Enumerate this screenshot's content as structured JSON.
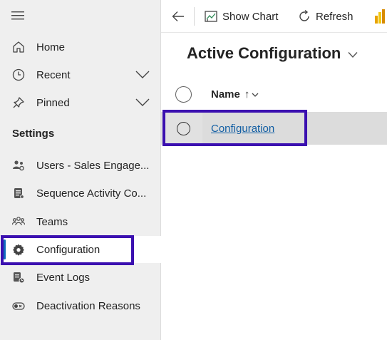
{
  "sidebar": {
    "items": [
      {
        "label": "Home",
        "icon": "home-icon"
      },
      {
        "label": "Recent",
        "icon": "clock-icon"
      },
      {
        "label": "Pinned",
        "icon": "pin-icon"
      }
    ],
    "section_title": "Settings",
    "settings_items": [
      {
        "label": "Users - Sales Engage...",
        "icon": "users-gear-icon"
      },
      {
        "label": "Sequence Activity Co...",
        "icon": "document-list-icon"
      },
      {
        "label": "Teams",
        "icon": "people-team-icon"
      },
      {
        "label": "Configuration",
        "icon": "gear-icon",
        "selected": true
      },
      {
        "label": "Event Logs",
        "icon": "log-clock-icon"
      },
      {
        "label": "Deactivation Reasons",
        "icon": "toggle-icon"
      }
    ]
  },
  "toolbar": {
    "show_chart_label": "Show Chart",
    "refresh_label": "Refresh"
  },
  "view": {
    "title": "Active Configuration"
  },
  "grid": {
    "column_name": "Name",
    "sort_indicator": "↑",
    "rows": [
      {
        "name": "Configuration"
      }
    ]
  },
  "colors": {
    "highlight_box": "#3b10b0",
    "link": "#115ea3",
    "selected_bar": "#0f6cbd",
    "sidebar_bg": "#efefef"
  }
}
